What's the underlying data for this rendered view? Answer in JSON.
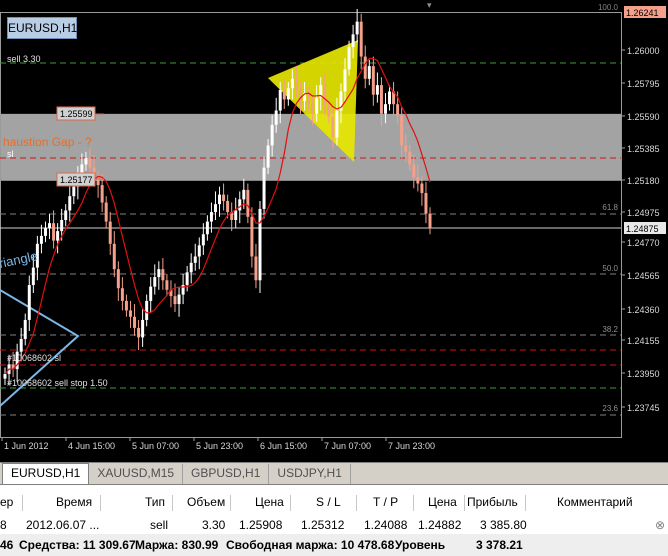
{
  "chart": {
    "symbol": "EURUSD,H1",
    "price_axis": [
      "1.26241",
      "1.26000",
      "1.25795",
      "1.25590",
      "1.25385",
      "1.25180",
      "1.24975",
      "1.24875",
      "1.24770",
      "1.24565",
      "1.24360",
      "1.24155",
      "1.23950",
      "1.23745"
    ],
    "top_label": "100.0",
    "time_axis": [
      "1 Jun 2012",
      "4 Jun 15:00",
      "5 Jun 07:00",
      "5 Jun 23:00",
      "6 Jun 15:00",
      "7 Jun 07:00",
      "7 Jun 23:00"
    ],
    "fib_levels": [
      "61.8",
      "50.0",
      "38.2",
      "23.6"
    ],
    "annotations": {
      "sell_label": "sell 3.30",
      "box_high": "1.25599",
      "box_low": "1.25177",
      "exhaustion": "haustion  Gap - ?",
      "sl": "sl",
      "triangle": "riangle",
      "order1": "#10068602 sl",
      "order2": "#10068602 sell stop 1.50"
    },
    "colors": {
      "background": "#000000",
      "bull": "#ffffff",
      "bear": "#f4a08a",
      "ma": "#e01010",
      "zone": "#c0c0c0",
      "triangle_yellow": "#e6e600",
      "triangle_blue": "#7ab8e8",
      "current_price": "#d0d0d0"
    }
  },
  "tabs": [
    "EURUSD,H1",
    "XAUUSD,M15",
    "GBPUSD,H1",
    "USDJPY,H1"
  ],
  "terminal": {
    "headers": {
      "order": "ер",
      "time": "Время",
      "type": "Тип",
      "volume": "Объем",
      "price": "Цена",
      "sl": "S / L",
      "tp": "T / P",
      "price2": "Цена",
      "profit": "Прибыль",
      "comment": "Комментарий"
    },
    "trade": {
      "order": "8",
      "time": "2012.06.07 ...",
      "type": "sell",
      "volume": "3.30",
      "price": "1.25908",
      "sl": "1.25312",
      "tp": "1.24088",
      "price2": "1.24882",
      "profit": "3 385.80",
      "comment": ""
    },
    "summary": {
      "prefix": "46",
      "equity": "Средства: 11 309.67",
      "margin": "Маржа: 830.99",
      "free_margin": "Свободная маржа: 10 478.68",
      "level": "Уровень",
      "total": "3 378.21"
    }
  }
}
